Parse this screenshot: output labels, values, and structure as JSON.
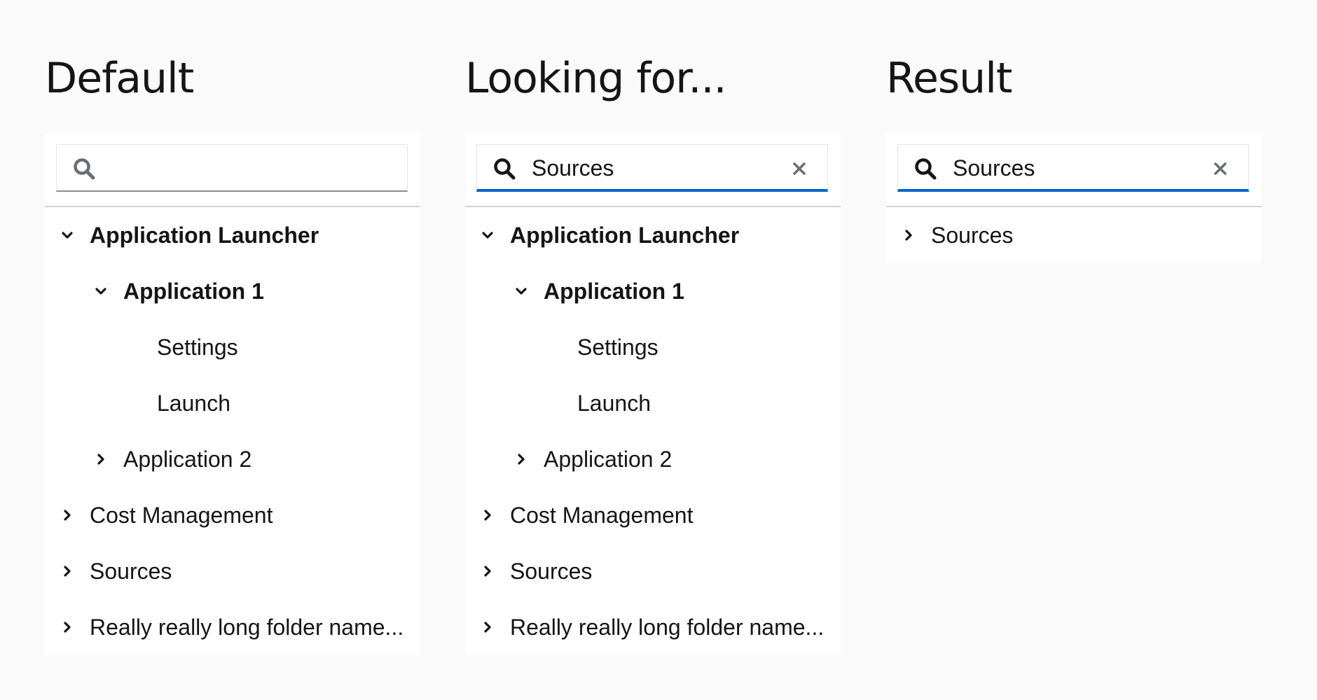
{
  "columns": [
    {
      "title": "Default",
      "search": {
        "value": "",
        "placeholder": "",
        "active": false,
        "clearable": false
      },
      "tree": [
        {
          "label": "Application Launcher",
          "level": 0,
          "expanded": true,
          "has_children": true,
          "bold": true
        },
        {
          "label": "Application 1",
          "level": 1,
          "expanded": true,
          "has_children": true,
          "bold": true
        },
        {
          "label": "Settings",
          "level": 2,
          "expanded": false,
          "has_children": false,
          "bold": false
        },
        {
          "label": "Launch",
          "level": 2,
          "expanded": false,
          "has_children": false,
          "bold": false
        },
        {
          "label": "Application 2",
          "level": 1,
          "expanded": false,
          "has_children": true,
          "bold": false
        },
        {
          "label": "Cost Management",
          "level": 0,
          "expanded": false,
          "has_children": true,
          "bold": false
        },
        {
          "label": "Sources",
          "level": 0,
          "expanded": false,
          "has_children": true,
          "bold": false
        },
        {
          "label": "Really really long folder name...",
          "level": 0,
          "expanded": false,
          "has_children": true,
          "bold": false
        }
      ]
    },
    {
      "title": "Looking for...",
      "search": {
        "value": "Sources",
        "placeholder": "",
        "active": true,
        "clearable": true
      },
      "tree": [
        {
          "label": "Application Launcher",
          "level": 0,
          "expanded": true,
          "has_children": true,
          "bold": true
        },
        {
          "label": "Application 1",
          "level": 1,
          "expanded": true,
          "has_children": true,
          "bold": true
        },
        {
          "label": "Settings",
          "level": 2,
          "expanded": false,
          "has_children": false,
          "bold": false
        },
        {
          "label": "Launch",
          "level": 2,
          "expanded": false,
          "has_children": false,
          "bold": false
        },
        {
          "label": "Application 2",
          "level": 1,
          "expanded": false,
          "has_children": true,
          "bold": false
        },
        {
          "label": "Cost Management",
          "level": 0,
          "expanded": false,
          "has_children": true,
          "bold": false
        },
        {
          "label": "Sources",
          "level": 0,
          "expanded": false,
          "has_children": true,
          "bold": false
        },
        {
          "label": "Really really long folder name...",
          "level": 0,
          "expanded": false,
          "has_children": true,
          "bold": false
        }
      ]
    },
    {
      "title": "Result",
      "search": {
        "value": "Sources",
        "placeholder": "",
        "active": true,
        "clearable": true
      },
      "tree": [
        {
          "label": "Sources",
          "level": 0,
          "expanded": false,
          "has_children": true,
          "bold": false
        }
      ]
    }
  ],
  "icons": {
    "search": "search-icon",
    "clear": "close-icon",
    "expanded": "chevron-down-icon",
    "collapsed": "chevron-right-icon"
  },
  "colors": {
    "background": "#fafafa",
    "panel": "#ffffff",
    "active_underline": "#0066cc",
    "inactive_underline": "#8a8d90",
    "search_icon_inactive": "#6a6e73",
    "search_icon_active": "#151515",
    "clear_icon": "#6a6e73",
    "text": "#151515"
  }
}
